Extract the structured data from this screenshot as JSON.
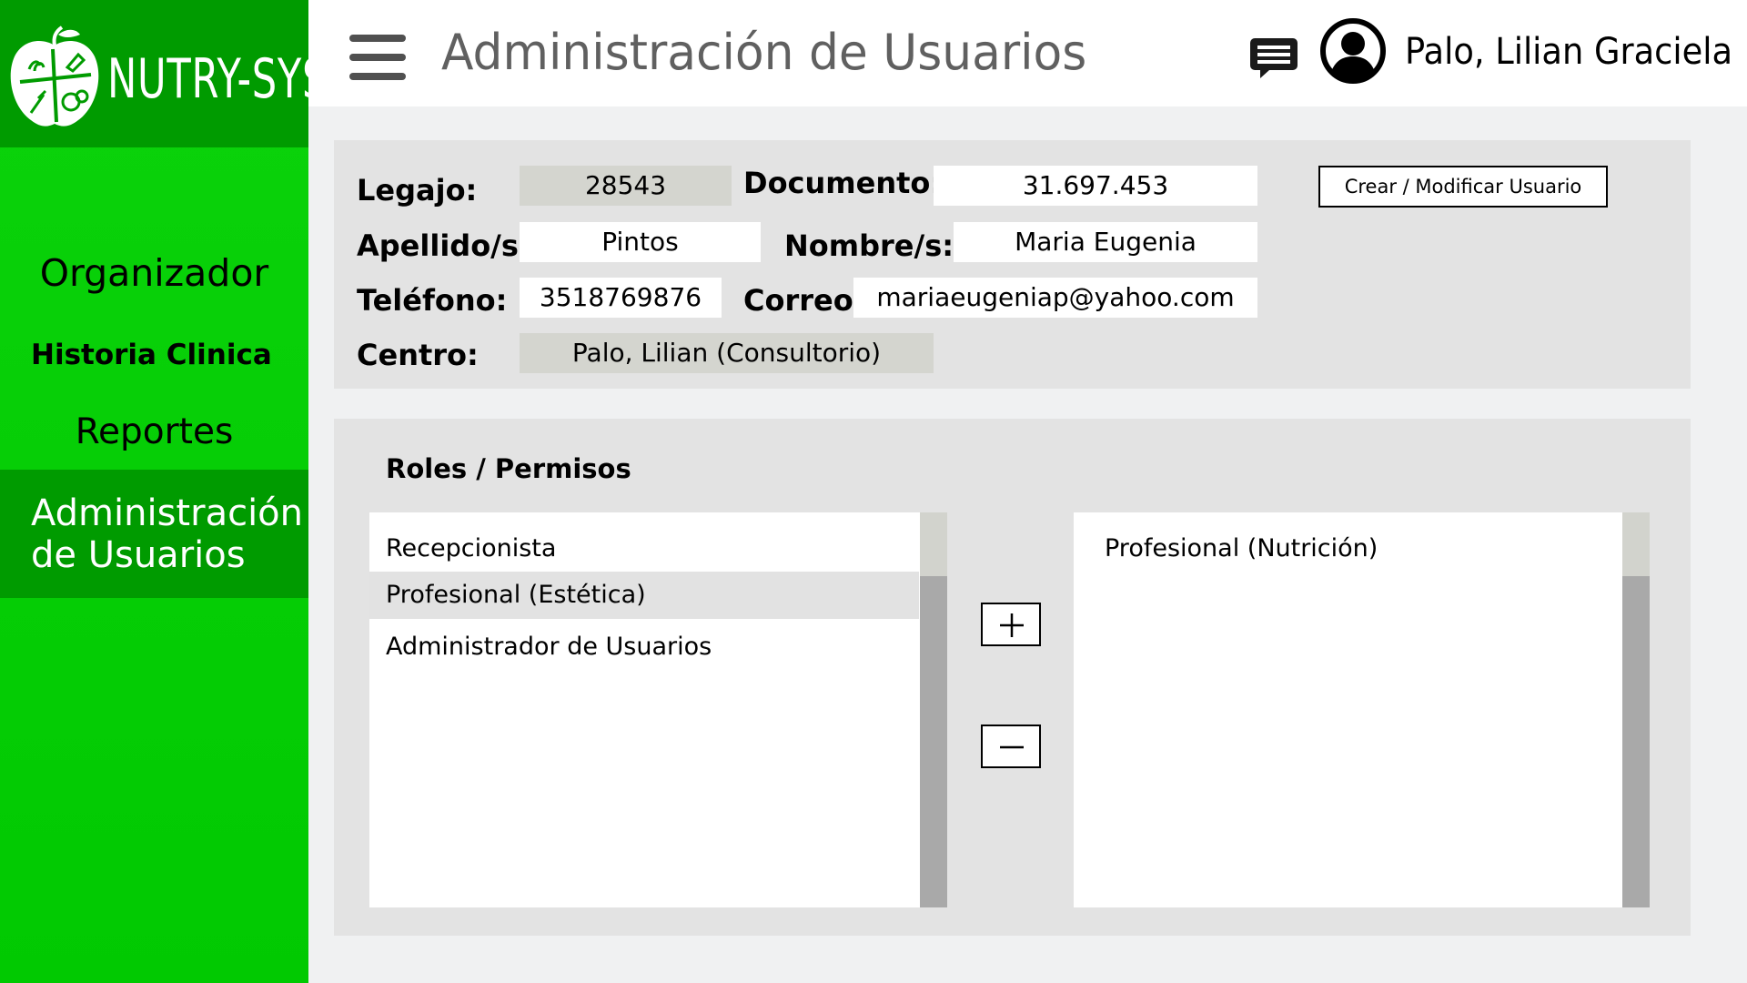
{
  "app": {
    "logo_text": "NUTRY-SYS"
  },
  "sidebar": {
    "items": [
      {
        "label": "Organizador"
      },
      {
        "label": "Historia Clinica"
      },
      {
        "label": "Reportes"
      },
      {
        "label": "Administración de Usuarios",
        "active": true
      }
    ]
  },
  "header": {
    "title": "Administración de Usuarios",
    "user_name": "Palo, Lilian Graciela",
    "icons": [
      "menu-icon",
      "chat-icon",
      "user-avatar-icon"
    ]
  },
  "form": {
    "legajo": {
      "label": "Legajo:",
      "value": "28543"
    },
    "documento": {
      "label": "Documento:",
      "value": "31.697.453"
    },
    "apellido": {
      "label": "Apellido/s:",
      "value": "Pintos"
    },
    "nombre": {
      "label": "Nombre/s:",
      "value": "Maria Eugenia"
    },
    "telefono": {
      "label": "Teléfono:",
      "value": "3518769876"
    },
    "correo": {
      "label": "Correo:",
      "value": "mariaeugeniap@yahoo.com"
    },
    "centro": {
      "label": "Centro:",
      "value": "Palo, Lilian (Consultorio)"
    },
    "submit_label": "Crear / Modificar Usuario"
  },
  "roles": {
    "title": "Roles / Permisos",
    "available": [
      "Recepcionista",
      "Profesional (Estética)",
      "Administrador de Usuarios"
    ],
    "selected_available_index": 1,
    "assigned": [
      "Profesional (Nutrición)"
    ],
    "add_icon": "plus-icon",
    "remove_icon": "minus-icon"
  },
  "colors": {
    "sidebar_green": "#01c901",
    "sidebar_dark_green": "#009b00",
    "panel_gray": "#e3e3e3",
    "readonly_field": "#d4d5cf"
  }
}
